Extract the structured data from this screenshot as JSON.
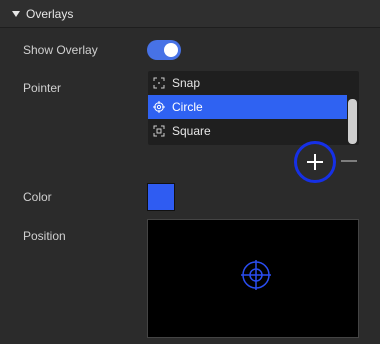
{
  "section": {
    "title": "Overlays",
    "expanded": true
  },
  "show_overlay": {
    "label": "Show Overlay",
    "enabled": true
  },
  "pointer": {
    "label": "Pointer",
    "options": [
      {
        "label": "Snap",
        "icon": "snap-icon"
      },
      {
        "label": "Circle",
        "icon": "crosshair-circle-icon",
        "selected": true
      },
      {
        "label": "Square",
        "icon": "square-target-icon"
      }
    ],
    "add_icon": "plus-icon",
    "remove_icon": "minus-icon"
  },
  "color": {
    "label": "Color",
    "value": "#2f5cf2"
  },
  "position": {
    "label": "Position",
    "marker_color": "#2a4df0"
  },
  "colors": {
    "accent": "#4772e6",
    "selection": "#2f62f2",
    "focus_ring": "#1630e6"
  }
}
